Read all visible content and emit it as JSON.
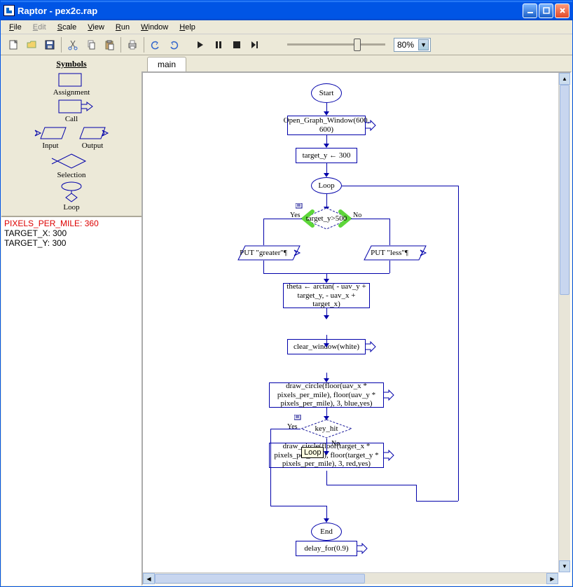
{
  "window": {
    "title": "Raptor - pex2c.rap"
  },
  "menu": {
    "file": "File",
    "edit": "Edit",
    "scale": "Scale",
    "view": "View",
    "run": "Run",
    "window": "Window",
    "help": "Help"
  },
  "toolbar": {
    "zoom": "80%"
  },
  "sidebar": {
    "symbols_title": "Symbols",
    "assignment": "Assignment",
    "call": "Call",
    "input": "Input",
    "output": "Output",
    "selection": "Selection",
    "loop": "Loop"
  },
  "vars": [
    {
      "text": "PIXELS_PER_MILE: 360",
      "selected": true
    },
    {
      "text": "TARGET_X: 300",
      "selected": false
    },
    {
      "text": "TARGET_Y: 300",
      "selected": false
    }
  ],
  "tab": {
    "main": "main"
  },
  "flow": {
    "start": "Start",
    "open_graph": "Open_Graph_Window(600, 600)",
    "target_y_assign": "target_y ← 300",
    "loop": "Loop",
    "cond1": "target_y>500",
    "yes1": "Yes",
    "no1": "No",
    "put_greater": "PUT \"greater\"¶",
    "put_less": "PUT \"less\"¶",
    "theta": "theta ← arctan( - uav_y + target_y, - uav_x + target_x)",
    "clear": "clear_window(white)",
    "draw1": "draw_circle(floor(uav_x * pixels_per_mile), floor(uav_y * pixels_per_mile), 3, blue,yes)",
    "draw2": "draw_circle(floor(target_x * pixels_per_mile), floor(target_y * pixels_per_mile), 3, red,yes)",
    "key_hit": "key_hit",
    "yes2": "Yes",
    "no2": "No",
    "delay": "delay_for(0.9)",
    "tooltip": "Loop",
    "end": "End"
  }
}
